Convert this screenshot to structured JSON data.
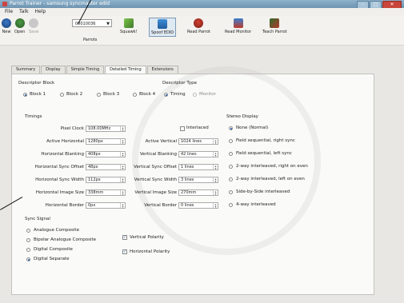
{
  "window": {
    "title": "Parrot Trainer - samsung syncmaster edid"
  },
  "menu": [
    "File",
    "Talk",
    "Help"
  ],
  "toolbar": {
    "new": "New",
    "open": "Open",
    "save": "Save",
    "parrot_value": "00010036",
    "parrots": "Parrots",
    "squawk": "Squawk!",
    "spoof_edid": "Spoof EDID",
    "read_parrot": "Read Parrot",
    "read_monitor": "Read Monitor",
    "teach_parrot": "Teach Parrot"
  },
  "tabs": [
    "Summary",
    "Display",
    "Simple Timing",
    "Detailed Timing",
    "Extensions"
  ],
  "descriptor_block": {
    "title": "Descriptor Block",
    "options": [
      "Block 1",
      "Block 2",
      "Block 3",
      "Block 4"
    ],
    "selected": "Block 1"
  },
  "descriptor_type": {
    "title": "Descriptor Type",
    "options": [
      "Timing",
      "Monitor"
    ],
    "selected": "Timing"
  },
  "timings": {
    "title": "Timings",
    "pixel_clock_label": "Pixel Clock",
    "pixel_clock": "108.00MHz",
    "interlaced": "Interlaced",
    "left": [
      {
        "label": "Active Horizontal",
        "value": "1280px"
      },
      {
        "label": "Horizontal Blanking",
        "value": "408px"
      },
      {
        "label": "Horizontal Sync Offset",
        "value": "48px"
      },
      {
        "label": "Horizontal Sync Width",
        "value": "112px"
      },
      {
        "label": "Horizontal Image Size",
        "value": "338mm"
      },
      {
        "label": "Horizontal Border",
        "value": "0px"
      }
    ],
    "right": [
      {
        "label": "Active Vertical",
        "value": "1024 lines"
      },
      {
        "label": "Vertical Blanking",
        "value": "42 lines"
      },
      {
        "label": "Vertical Sync Offset",
        "value": "1 lines"
      },
      {
        "label": "Vertical Sync Width",
        "value": "3 lines"
      },
      {
        "label": "Vertical Image Size",
        "value": "270mm"
      },
      {
        "label": "Vertical Border",
        "value": "0 lines"
      }
    ]
  },
  "stereo": {
    "title": "Stereo Display",
    "options": [
      "None (Normal)",
      "Field sequential, right sync",
      "Field sequential, left sync",
      "2-way interleaved, right on even",
      "2-way interleaved, left on even",
      "Side-by-Side interleaved",
      "4-way interleaved"
    ],
    "selected": "None (Normal)"
  },
  "sync": {
    "title": "Sync Signal",
    "options": [
      "Analogue Composite",
      "Bipolar Analogue Composite",
      "Digital Composite",
      "Digital Separate"
    ],
    "selected": "Digital Separate",
    "vertical_polarity": "Vertical Polarity",
    "horizontal_polarity": "Horizontal Polarity"
  }
}
